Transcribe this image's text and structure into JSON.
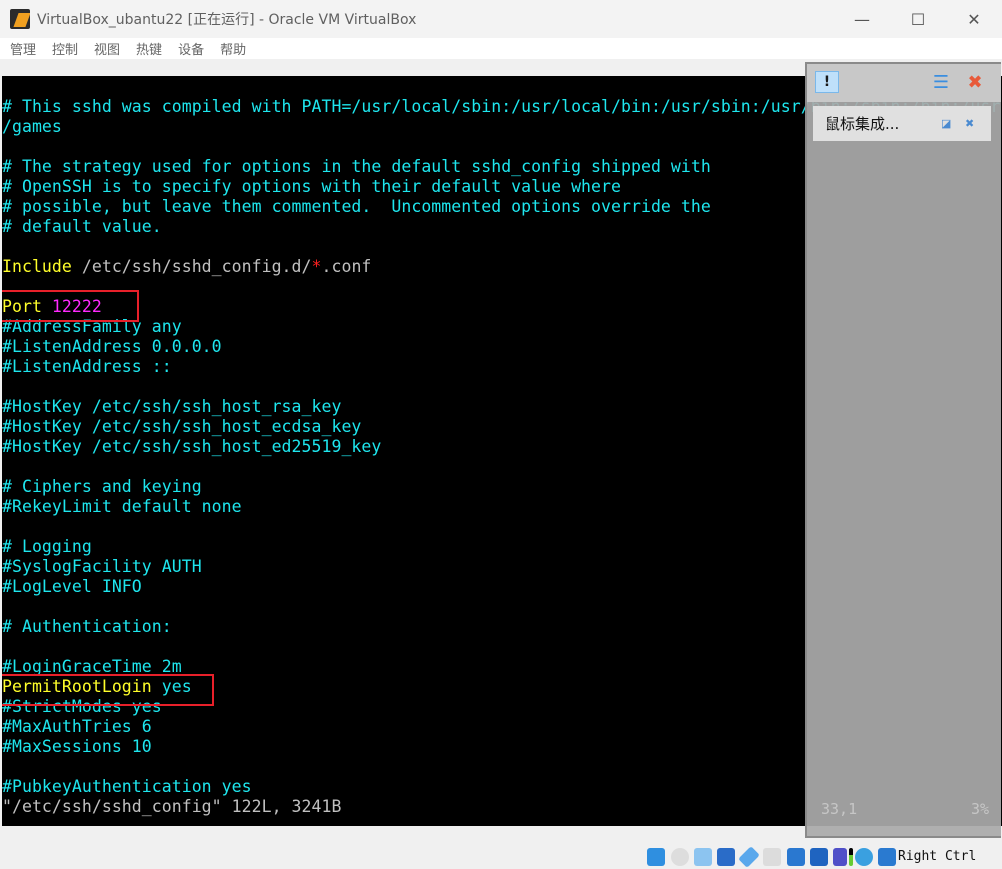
{
  "window": {
    "title": "VirtualBox_ubantu22 [正在运行] - Oracle VM VirtualBox",
    "minimize": "—",
    "maximize": "☐",
    "close": "✕"
  },
  "menu": [
    "管理",
    "控制",
    "视图",
    "热键",
    "设备",
    "帮助"
  ],
  "colors": {
    "cyan": "#1ee6ee",
    "yellow": "#ffff2a",
    "magenta": "#ff2aff",
    "gray": "#c0c0c0",
    "red": "#ff2020",
    "highlight": "#e8202a"
  },
  "terminal": {
    "lines": [
      [
        [
          "# This sshd was compiled with PATH=/usr/local/sbin:/usr/local/bin:/usr/sbin:/usr/bin:/sbin:/bin:/usr",
          "cyan"
        ]
      ],
      [
        [
          "/games",
          "cyan"
        ]
      ],
      [],
      [
        [
          "# The strategy used for options in the default sshd_config shipped with",
          "cyan"
        ]
      ],
      [
        [
          "# OpenSSH is to specify options with their default value where",
          "cyan"
        ]
      ],
      [
        [
          "# possible, but leave them commented.  Uncommented options override the",
          "cyan"
        ]
      ],
      [
        [
          "# default value.",
          "cyan"
        ]
      ],
      [],
      [
        [
          "Include",
          "yellow"
        ],
        [
          " /etc/ssh/sshd_config.d/",
          "gray"
        ],
        [
          "*",
          "red"
        ],
        [
          ".conf",
          "gray"
        ]
      ],
      [],
      [
        [
          "Port ",
          "yellow"
        ],
        [
          "12222",
          "magenta"
        ]
      ],
      [
        [
          "#AddressFamily any",
          "cyan"
        ]
      ],
      [
        [
          "#ListenAddress 0.0.0.0",
          "cyan"
        ]
      ],
      [
        [
          "#ListenAddress ::",
          "cyan"
        ]
      ],
      [],
      [
        [
          "#HostKey /etc/ssh/ssh_host_rsa_key",
          "cyan"
        ]
      ],
      [
        [
          "#HostKey /etc/ssh/ssh_host_ecdsa_key",
          "cyan"
        ]
      ],
      [
        [
          "#HostKey /etc/ssh/ssh_host_ed25519_key",
          "cyan"
        ]
      ],
      [],
      [
        [
          "# Ciphers and keying",
          "cyan"
        ]
      ],
      [
        [
          "#RekeyLimit default none",
          "cyan"
        ]
      ],
      [],
      [
        [
          "# Logging",
          "cyan"
        ]
      ],
      [
        [
          "#SyslogFacility AUTH",
          "cyan"
        ]
      ],
      [
        [
          "#LogLevel INFO",
          "cyan"
        ]
      ],
      [],
      [
        [
          "# Authentication:",
          "cyan"
        ]
      ],
      [],
      [
        [
          "#LoginGraceTime 2m",
          "cyan"
        ]
      ],
      [
        [
          "PermitRootLogin",
          "yellow"
        ],
        [
          " yes",
          "cyan"
        ]
      ],
      [
        [
          "#StrictModes yes",
          "cyan"
        ]
      ],
      [
        [
          "#MaxAuthTries 6",
          "cyan"
        ]
      ],
      [
        [
          "#MaxSessions 10",
          "cyan"
        ]
      ],
      [],
      [
        [
          "#PubkeyAuthentication yes",
          "cyan"
        ]
      ],
      [
        [
          "\"/etc/ssh/sshd_config\" 122L, 3241B",
          "gray"
        ]
      ]
    ],
    "cursor_pos": "33,1",
    "scroll_pct": "3%"
  },
  "notification_panel": {
    "popup_text": "鼠标集成...",
    "icons": [
      "notification-icon",
      "sort-icon",
      "close-all-icon"
    ]
  },
  "statusbar": {
    "host_key": "Right Ctrl",
    "icons": [
      "hard-disk-icon",
      "optical-drive-icon",
      "audio-icon",
      "network-icon",
      "usb-icon",
      "shared-folder-icon",
      "display-icon",
      "recording-icon",
      "cpu-icon",
      "mouse-integration-icon",
      "keyboard-icon"
    ]
  }
}
